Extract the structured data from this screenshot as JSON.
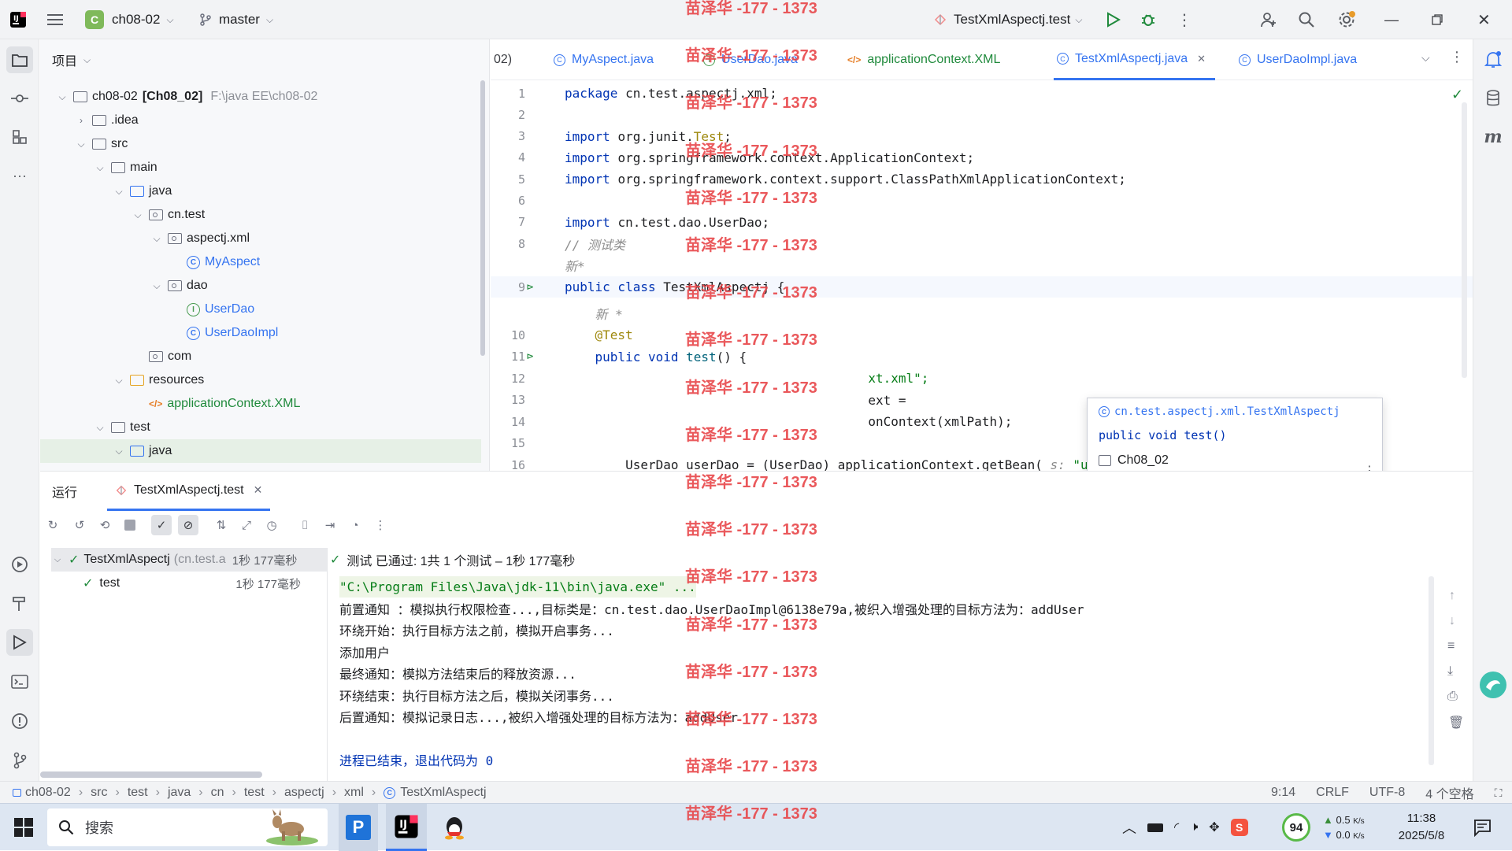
{
  "titlebar": {
    "project_badge": "C",
    "project_name": "ch08-02",
    "branch": "master",
    "run_config": "TestXmlAspectj.test"
  },
  "project_panel": {
    "title": "项目",
    "tree": [
      {
        "label": "ch08-02",
        "bold": "[Ch08_02]",
        "path": "F:\\java EE\\ch08-02",
        "level": 0,
        "kind": "module",
        "open": true
      },
      {
        "label": ".idea",
        "level": 1,
        "kind": "folder",
        "open": false
      },
      {
        "label": "src",
        "level": 1,
        "kind": "folder",
        "open": true
      },
      {
        "label": "main",
        "level": 2,
        "kind": "folder",
        "open": true
      },
      {
        "label": "java",
        "level": 3,
        "kind": "srcfolder",
        "open": true
      },
      {
        "label": "cn.test",
        "level": 4,
        "kind": "package",
        "open": true
      },
      {
        "label": "aspectj.xml",
        "level": 5,
        "kind": "package",
        "open": true
      },
      {
        "label": "MyAspect",
        "level": 6,
        "kind": "class"
      },
      {
        "label": "dao",
        "level": 5,
        "kind": "package",
        "open": true
      },
      {
        "label": "UserDao",
        "level": 6,
        "kind": "interface"
      },
      {
        "label": "UserDaoImpl",
        "level": 6,
        "kind": "class"
      },
      {
        "label": "com",
        "level": 4,
        "kind": "package"
      },
      {
        "label": "resources",
        "level": 3,
        "kind": "resfolder",
        "open": true
      },
      {
        "label": "applicationContext.XML",
        "level": 4,
        "kind": "xml"
      },
      {
        "label": "test",
        "level": 2,
        "kind": "folder",
        "open": true
      },
      {
        "label": "java",
        "level": 3,
        "kind": "testfolder",
        "open": true
      }
    ]
  },
  "editor": {
    "tabs": [
      {
        "label": "02)",
        "kind": "partial"
      },
      {
        "label": "MyAspect.java",
        "kind": "class"
      },
      {
        "label": "UserDao.java",
        "kind": "interface"
      },
      {
        "label": "applicationContext.XML",
        "kind": "xml"
      },
      {
        "label": "TestXmlAspectj.java",
        "kind": "class",
        "active": true
      },
      {
        "label": "UserDaoImpl.java",
        "kind": "class"
      }
    ],
    "lines": [
      {
        "n": "1",
        "parts": [
          [
            "kw",
            "package "
          ],
          [
            "",
            "cn.test.aspectj.xml;"
          ]
        ]
      },
      {
        "n": "2",
        "parts": []
      },
      {
        "n": "3",
        "parts": [
          [
            "kw",
            "import "
          ],
          [
            "",
            "org.junit."
          ],
          [
            "ann",
            "Test"
          ],
          [
            "",
            ";"
          ]
        ]
      },
      {
        "n": "4",
        "parts": [
          [
            "kw",
            "import "
          ],
          [
            "",
            "org.springframework.context.ApplicationContext;"
          ]
        ]
      },
      {
        "n": "5",
        "parts": [
          [
            "kw",
            "import "
          ],
          [
            "",
            "org.springframework.context.support.ClassPathXmlApplicationContext;"
          ]
        ]
      },
      {
        "n": "6",
        "parts": []
      },
      {
        "n": "7",
        "parts": [
          [
            "kw",
            "import "
          ],
          [
            "",
            "cn.test.dao.UserDao;"
          ]
        ]
      },
      {
        "n": "8",
        "parts": [
          [
            "cm",
            "// 测试类"
          ]
        ]
      },
      {
        "n": "",
        "parts": [
          [
            "cm",
            "新*"
          ]
        ]
      },
      {
        "n": "9",
        "parts": [
          [
            "kw",
            "public class "
          ],
          [
            "",
            "TestXmlAspectj {"
          ]
        ]
      },
      {
        "n": "",
        "parts": [
          [
            "cm",
            "    新 *"
          ]
        ]
      },
      {
        "n": "10",
        "parts": [
          [
            "ann",
            "    @Test"
          ]
        ]
      },
      {
        "n": "11",
        "parts": [
          [
            "kw",
            "    public void "
          ],
          [
            "fn",
            "test"
          ],
          [
            "",
            "() {"
          ]
        ]
      },
      {
        "n": "12",
        "parts": [
          [
            "",
            "                                        "
          ],
          [
            "str",
            "xt.xml\";"
          ]
        ]
      },
      {
        "n": "13",
        "parts": [
          [
            "",
            "                                        ext ="
          ]
        ]
      },
      {
        "n": "14",
        "parts": [
          [
            "",
            "                                        onContext(xmlPath);"
          ]
        ]
      },
      {
        "n": "15",
        "parts": []
      },
      {
        "n": "16",
        "parts": [
          [
            "",
            "        UserDao userDao = (UserDao) applicationContext.getBean( "
          ],
          [
            "cm",
            "s: "
          ],
          [
            "str",
            "\"userDao\""
          ],
          [
            "",
            ");"
          ]
        ]
      }
    ],
    "popup": {
      "fqcn": "cn.test.aspectj.xml.TestXmlAspectj",
      "signature": "public void test()",
      "module": "Ch08_02"
    }
  },
  "run_panel": {
    "tab_run": "运行",
    "tab_config": "TestXmlAspectj.test",
    "status": "测试 已通过: 1共 1 个测试 – 1秒 177毫秒",
    "tree": [
      {
        "label": "TestXmlAspectj",
        "extra": "(cn.test.a",
        "time": "1秒 177毫秒"
      },
      {
        "label": "test",
        "extra": "",
        "time": "1秒 177毫秒"
      }
    ],
    "console": [
      {
        "text": "\"C:\\Program Files\\Java\\jdk-11\\bin\\java.exe\" ...",
        "kind": "cmd"
      },
      {
        "text": "前置通知 ：模拟执行权限检查...,目标类是：cn.test.dao.UserDaoImpl@6138e79a,被织入增强处理的目标方法为：addUser",
        "kind": "out"
      },
      {
        "text": "环绕开始：执行目标方法之前，模拟开启事务...",
        "kind": "out"
      },
      {
        "text": "添加用户",
        "kind": "out"
      },
      {
        "text": "最终通知：模拟方法结束后的释放资源...",
        "kind": "out"
      },
      {
        "text": "环绕结束：执行目标方法之后，模拟关闭事务...",
        "kind": "out"
      },
      {
        "text": "后置通知：模拟记录日志...,被织入增强处理的目标方法为：addUser",
        "kind": "out"
      },
      {
        "text": "",
        "kind": "out"
      },
      {
        "text": "进程已结束，退出代码为 0",
        "kind": "exit"
      }
    ]
  },
  "statusbar": {
    "breadcrumbs": [
      "ch08-02",
      "src",
      "test",
      "java",
      "cn",
      "test",
      "aspectj",
      "xml",
      "TestXmlAspectj"
    ],
    "position": "9:14",
    "line_sep": "CRLF",
    "encoding": "UTF-8",
    "indent": "4 个空格"
  },
  "taskbar": {
    "search": "搜索",
    "battery": "94",
    "net_up": "0.5",
    "net_down": "0.0",
    "net_unit": "K/s",
    "time": "11:38",
    "date": "2025/5/8"
  },
  "watermark": "苗泽华 -177 - 1373"
}
